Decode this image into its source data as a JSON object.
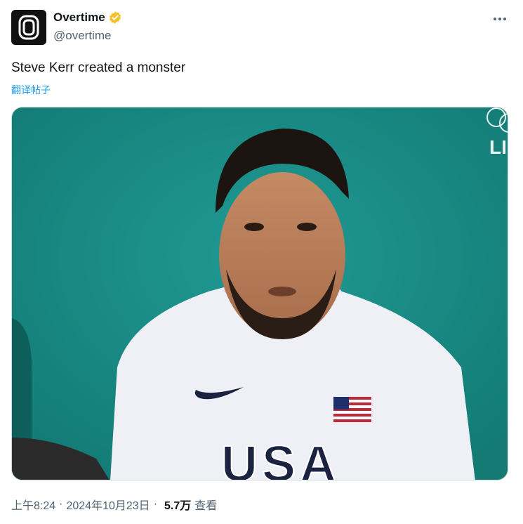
{
  "author": {
    "display_name": "Overtime",
    "handle": "@overtime",
    "verified": true,
    "avatar_icon": "overtime-logo-icon"
  },
  "tweet": {
    "text": "Steve Kerr created a monster",
    "translate_label": "翻译帖子"
  },
  "media": {
    "corner_text": "LI",
    "shirt_text": "USA"
  },
  "meta": {
    "time": "上午8:24",
    "separator": "·",
    "date": "2024年10月23日",
    "views_count": "5.7万",
    "views_label": "查看"
  },
  "colors": {
    "verified_badge": "#f4c12a",
    "link": "#1d9bf0",
    "secondary_text": "#536471",
    "court_background": "#1a8c86"
  }
}
